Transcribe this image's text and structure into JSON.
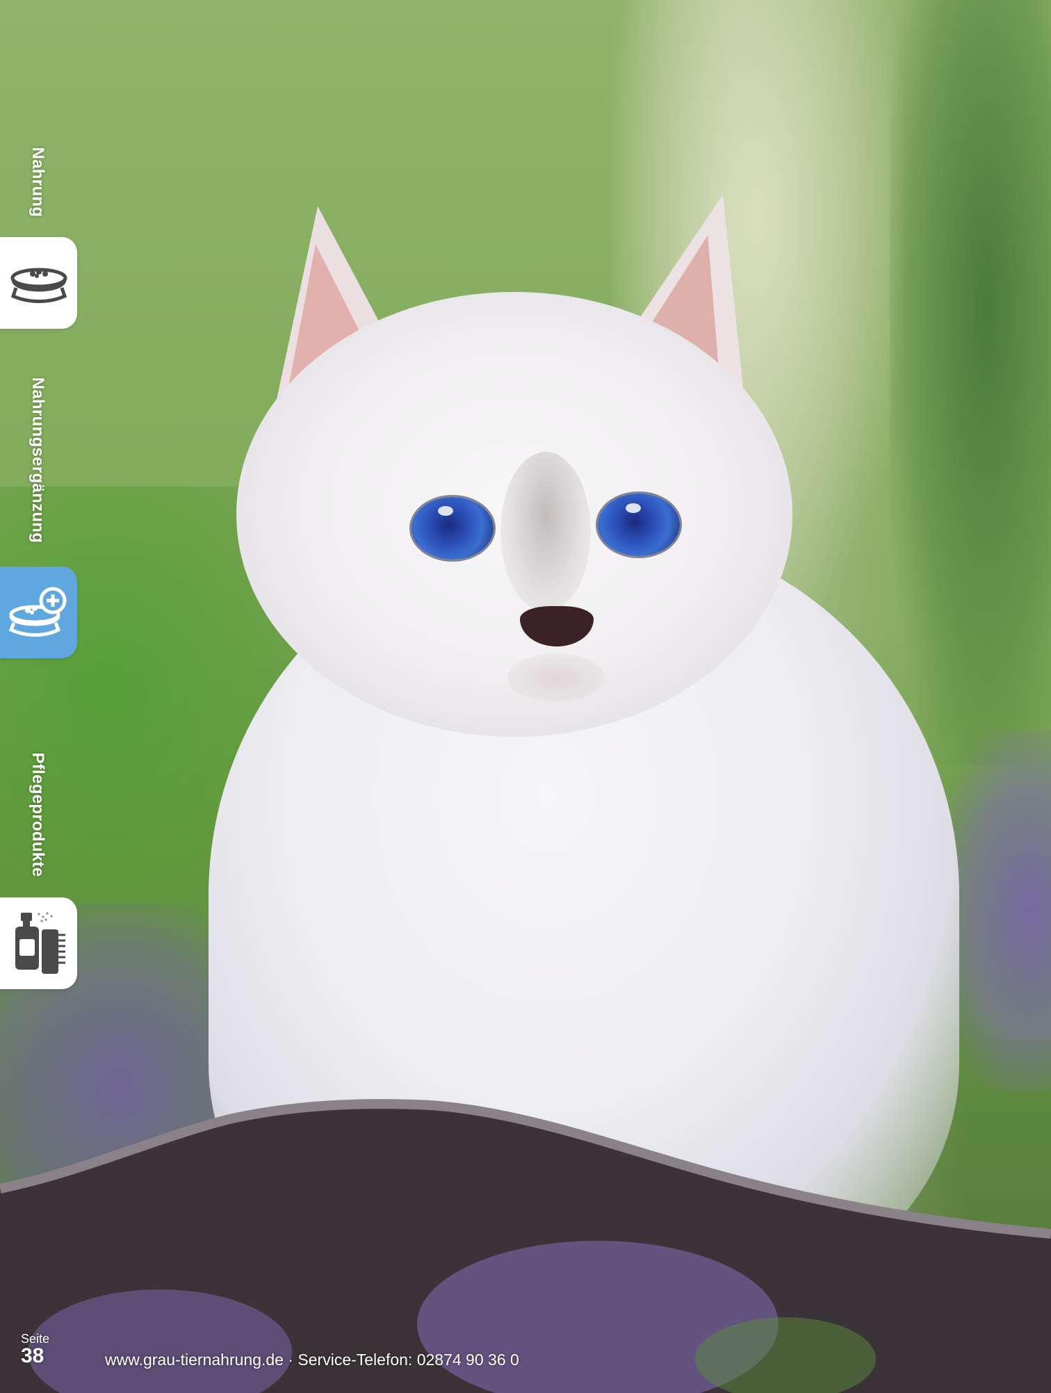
{
  "nav": {
    "sections": [
      {
        "label": "Nahrung",
        "icon": "food-bowl-icon",
        "active": false
      },
      {
        "label": "Nahrungsergänzung",
        "icon": "supplement-bowl-icon",
        "active": true
      },
      {
        "label": "Pflegeprodukte",
        "icon": "care-products-icon",
        "active": false
      }
    ],
    "active_color": "#5fa7df"
  },
  "photo": {
    "subject": "kitten-photo"
  },
  "footer": {
    "page_label": "Seite",
    "page_number": "38",
    "website_and_phone": "www.grau-tiernahrung.de · Service-Telefon: 02874 90 36 0"
  }
}
